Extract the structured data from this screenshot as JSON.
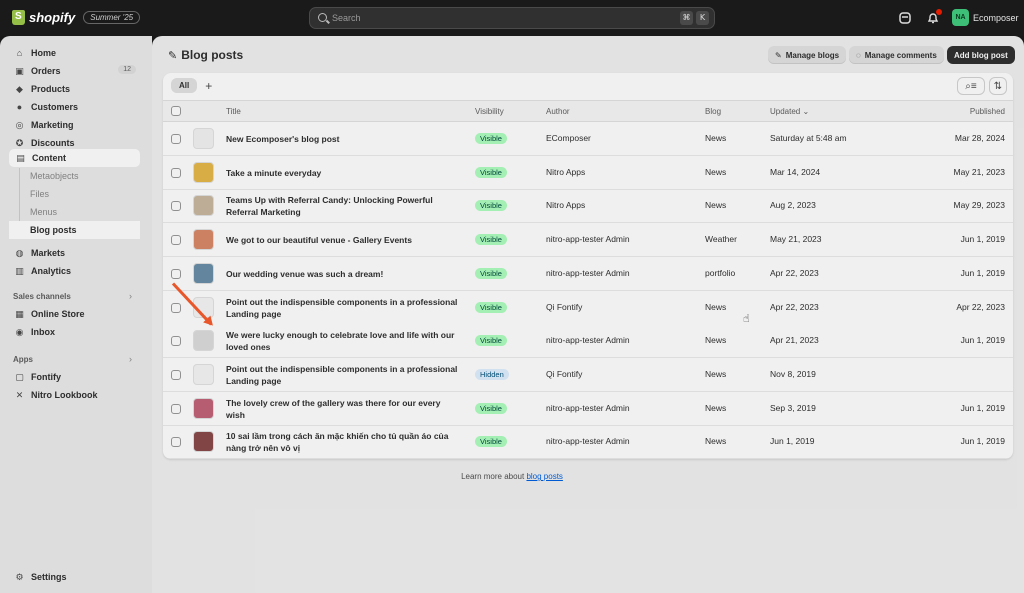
{
  "topbar": {
    "brand": "shopify",
    "edition": "Summer '25",
    "search_placeholder": "Search",
    "shortcut_keys": [
      "⌘",
      "K"
    ],
    "avatar_initials": "NA",
    "store_name": "Ecomposer"
  },
  "sidebar": {
    "items": [
      {
        "label": "Home",
        "icon": "home-icon"
      },
      {
        "label": "Orders",
        "icon": "orders-icon",
        "count": "12"
      },
      {
        "label": "Products",
        "icon": "tag-icon"
      },
      {
        "label": "Customers",
        "icon": "person-icon"
      },
      {
        "label": "Marketing",
        "icon": "target-icon"
      },
      {
        "label": "Discounts",
        "icon": "discount-icon"
      },
      {
        "label": "Content",
        "icon": "content-icon"
      }
    ],
    "content_sub": [
      "Metaobjects",
      "Files",
      "Menus",
      "Blog posts"
    ],
    "items2": [
      {
        "label": "Markets",
        "icon": "globe-icon"
      },
      {
        "label": "Analytics",
        "icon": "chart-icon"
      }
    ],
    "sales_channels_label": "Sales channels",
    "sales_channels": [
      {
        "label": "Online Store",
        "icon": "store-icon"
      },
      {
        "label": "Inbox",
        "icon": "inbox-icon"
      }
    ],
    "apps_label": "Apps",
    "apps": [
      {
        "label": "Fontify",
        "icon": "app-icon"
      },
      {
        "label": "Nitro Lookbook",
        "icon": "app-icon"
      }
    ],
    "settings_label": "Settings"
  },
  "page": {
    "title": "Blog posts",
    "buttons": {
      "manage_blogs": "Manage blogs",
      "manage_comments": "Manage comments",
      "add_blog_post": "Add blog post"
    },
    "tab_all": "All",
    "tab_add": "+"
  },
  "table": {
    "columns": {
      "title": "Title",
      "visibility": "Visibility",
      "author": "Author",
      "blog": "Blog",
      "updated": "Updated",
      "published": "Published"
    },
    "rows": [
      {
        "title": "New Ecomposer's blog post",
        "visibility": "Visible",
        "author": "EComposer",
        "blog": "News",
        "updated": "Saturday at 5:48 am",
        "published": "Mar 28, 2024",
        "thumb": "#f3f3f3"
      },
      {
        "title": "Take a minute everyday",
        "visibility": "Visible",
        "author": "Nitro Apps",
        "blog": "News",
        "updated": "Mar 14, 2024",
        "published": "May 21, 2023",
        "thumb": "#e7b84a"
      },
      {
        "title": "Teams Up with Referral Candy: Unlocking Powerful Referral Marketing",
        "visibility": "Visible",
        "author": "Nitro Apps",
        "blog": "News",
        "updated": "Aug 2, 2023",
        "published": "May 29, 2023",
        "thumb": "#c9b8a0"
      },
      {
        "title": "We got to our beautiful venue - Gallery Events",
        "visibility": "Visible",
        "author": "nitro-app-tester Admin",
        "blog": "Weather",
        "updated": "May 21, 2023",
        "published": "Jun 1, 2019",
        "thumb": "#d98a6a"
      },
      {
        "title": "Our wedding venue was such a dream!",
        "visibility": "Visible",
        "author": "nitro-app-tester Admin",
        "blog": "portfolio",
        "updated": "Apr 22, 2023",
        "published": "Jun 1, 2019",
        "thumb": "#6a8fa8"
      },
      {
        "title": "Point out the indispensible components in a professional Landing page",
        "visibility": "Visible",
        "author": "Qi Fontify",
        "blog": "News",
        "updated": "Apr 22, 2023",
        "published": "Apr 22, 2023",
        "thumb": "#f6f6f6"
      },
      {
        "title": "We were lucky enough to celebrate love and life with our loved ones",
        "visibility": "Visible",
        "author": "nitro-app-tester Admin",
        "blog": "News",
        "updated": "Apr 21, 2023",
        "published": "Jun 1, 2019",
        "thumb": "#dcdcdc"
      },
      {
        "title": "Point out the indispensible components in a professional Landing page",
        "visibility": "Hidden",
        "author": "Qi Fontify",
        "blog": "News",
        "updated": "Nov 8, 2019",
        "published": "",
        "thumb": "#f6f6f6"
      },
      {
        "title": "The lovely crew of the gallery was there for our every wish",
        "visibility": "Visible",
        "author": "nitro-app-tester Admin",
        "blog": "News",
        "updated": "Sep 3, 2019",
        "published": "Jun 1, 2019",
        "thumb": "#c2637a"
      },
      {
        "title": "10 sai lầm trong cách ăn mặc khiến cho tủ quần áo của nàng trở nên vô vị",
        "visibility": "Visible",
        "author": "nitro-app-tester Admin",
        "blog": "News",
        "updated": "Jun 1, 2019",
        "published": "Jun 1, 2019",
        "thumb": "#8a4a4a"
      }
    ]
  },
  "footer": {
    "text": "Learn more about ",
    "link": "blog posts"
  },
  "colors": {
    "accent_arrow": "#e8562a",
    "badge_visible_bg": "#affebf",
    "badge_hidden_bg": "#e0f0ff"
  }
}
